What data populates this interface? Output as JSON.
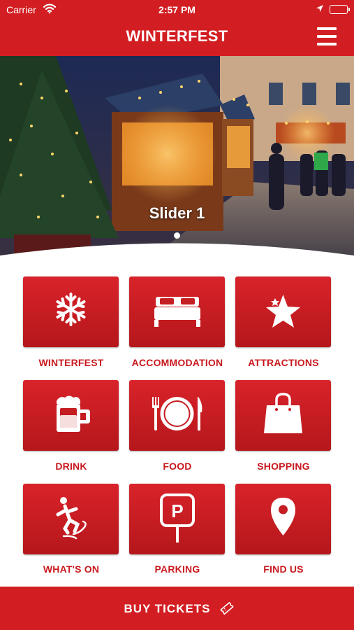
{
  "status_bar": {
    "carrier": "Carrier",
    "time": "2:57 PM"
  },
  "nav": {
    "title": "WINTERFEST"
  },
  "hero": {
    "slide_title": "Slider 1",
    "slide_count": 1,
    "active_slide": 1
  },
  "tiles": [
    {
      "label": "WINTERFEST",
      "icon": "snowflake-icon"
    },
    {
      "label": "ACCOMMODATION",
      "icon": "bed-icon"
    },
    {
      "label": "ATTRACTIONS",
      "icon": "star-icon"
    },
    {
      "label": "DRINK",
      "icon": "beer-mug-icon"
    },
    {
      "label": "FOOD",
      "icon": "plate-cutlery-icon"
    },
    {
      "label": "SHOPPING",
      "icon": "shopping-bag-icon"
    },
    {
      "label": "WHAT'S ON",
      "icon": "skater-icon"
    },
    {
      "label": "PARKING",
      "icon": "parking-sign-icon"
    },
    {
      "label": "FIND US",
      "icon": "map-pin-icon"
    }
  ],
  "footer": {
    "buy_tickets_label": "BUY TICKETS",
    "icon": "ticket-icon"
  },
  "colors": {
    "brand_red": "#d21e22",
    "tile_red": "#c8191e",
    "background": "#ffffff"
  }
}
